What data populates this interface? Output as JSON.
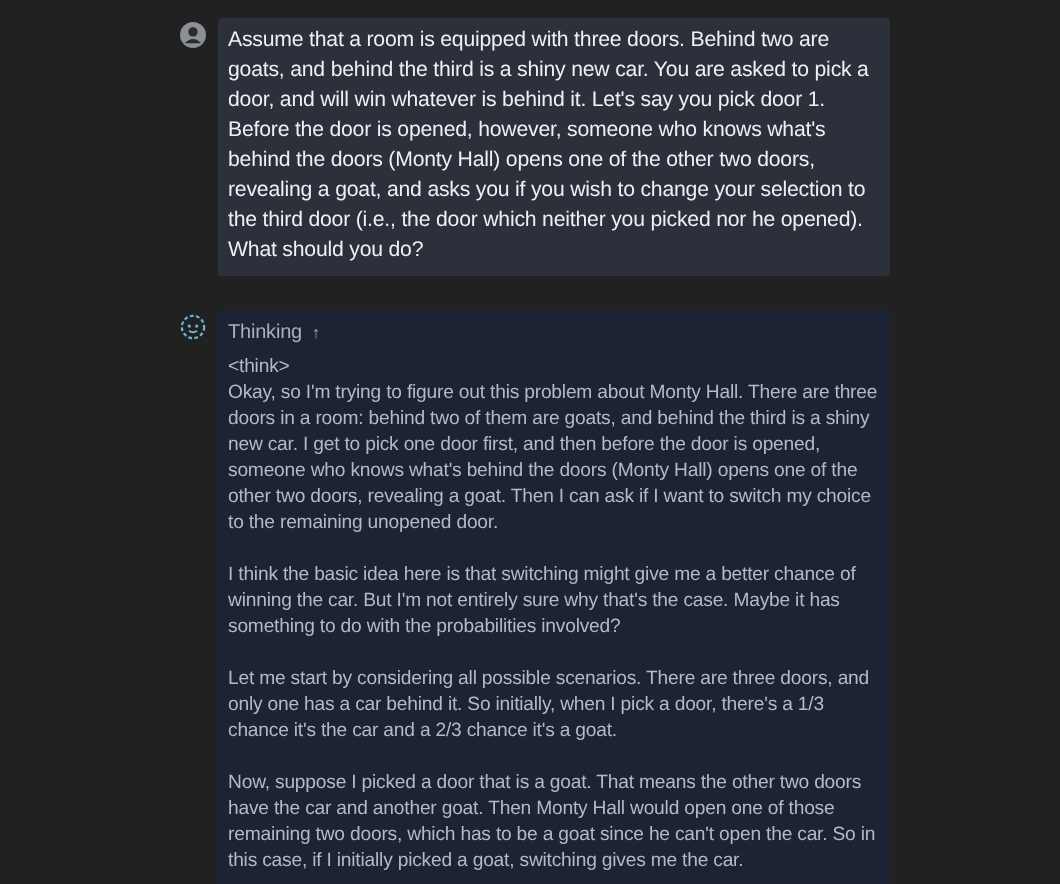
{
  "user_message": {
    "text": "Assume that a room is equipped with three doors. Behind two are goats, and behind the third is a shiny new car. You are asked to pick a door, and will win whatever is behind it. Let's say you pick door 1. Before the door is opened, however, someone who knows what's behind the doors (Monty Hall) opens one of the other two doors, revealing a goat, and asks you if you wish to change your selection to the third door (i.e., the door which neither you picked nor he opened). What should you do?"
  },
  "assistant_message": {
    "thinking_label": "Thinking",
    "toggle": "↑",
    "paragraphs": [
      "<think>\nOkay, so I'm trying to figure out this problem about Monty Hall. There are three doors in a room: behind two of them are goats, and behind the third is a shiny new car. I get to pick one door first, and then before the door is opened, someone who knows what's behind the doors (Monty Hall) opens one of the other two doors, revealing a goat. Then I can ask if I want to switch my choice to the remaining unopened door.",
      "I think the basic idea here is that switching might give me a better chance of winning the car. But I'm not entirely sure why that's the case. Maybe it has something to do with the probabilities involved?",
      "Let me start by considering all possible scenarios. There are three doors, and only one has a car behind it. So initially, when I pick a door, there's a 1/3 chance it's the car and a 2/3 chance it's a goat.",
      "Now, suppose I picked a door that is a goat. That means the other two doors have the car and another goat. Then Monty Hall would open one of those remaining two doors, which has to be a goat since he can't open the car. So in this case, if I initially picked a goat, switching gives me the car."
    ]
  }
}
